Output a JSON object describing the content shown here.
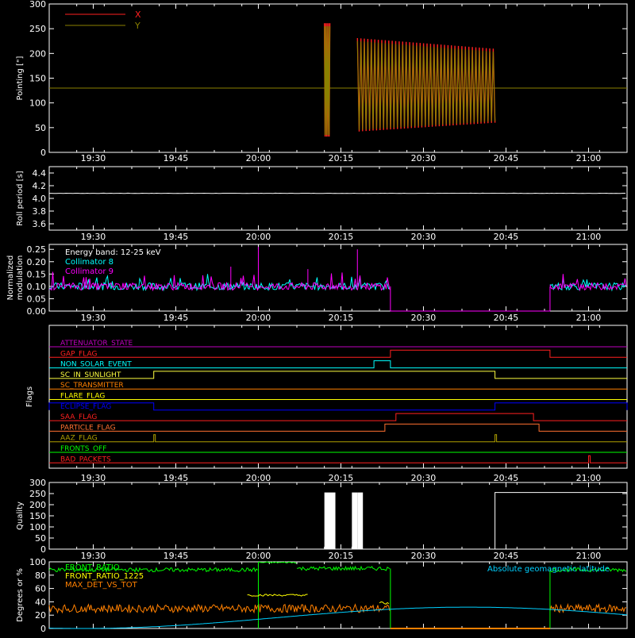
{
  "chart_data": [
    {
      "type": "line",
      "ylabel": "Pointing [\"]",
      "ylim": [
        0,
        300
      ],
      "yticks": [
        0,
        50,
        100,
        150,
        200,
        250,
        300
      ],
      "xlim": [
        "19:22",
        "21:07"
      ],
      "xticks": [
        "19:30",
        "19:45",
        "20:00",
        "20:15",
        "20:30",
        "20:45",
        "21:00"
      ],
      "legend": [
        {
          "name": "X",
          "color": "#ff2020"
        },
        {
          "name": "Y",
          "color": "#8b8000"
        }
      ],
      "baseline": 130,
      "bursts": [
        {
          "start": "20:12",
          "end": "20:13",
          "low": 35,
          "high": 255
        },
        {
          "start": "20:18",
          "end": "20:43",
          "low": 45,
          "high": 225
        }
      ]
    },
    {
      "type": "line",
      "ylabel": "Roll period [s]",
      "ylim": [
        3.5,
        4.5
      ],
      "yticks": [
        "3.6",
        "3.8",
        "4.0",
        "4.2",
        "4.4"
      ],
      "value": 4.08,
      "series": [
        {
          "color": "#ffffff"
        }
      ]
    },
    {
      "type": "line",
      "ylabel": "Normalized modulation",
      "ylim": [
        0,
        0.27
      ],
      "yticks": [
        "0.00",
        "0.05",
        "0.10",
        "0.15",
        "0.20",
        "0.25"
      ],
      "annotation": "Energy band: 12-25 keV",
      "series": [
        {
          "name": "Collimator 8",
          "color": "#00ffff",
          "level": 0.1
        },
        {
          "name": "Collimator 9",
          "color": "#ff00ff",
          "level": 0.1
        }
      ],
      "gap": {
        "start": "20:24",
        "end": "20:53"
      }
    },
    {
      "type": "line",
      "ylabel": "Flags",
      "flags": [
        {
          "name": "ATTENUATOR_STATE",
          "color": "#c000c0",
          "high": []
        },
        {
          "name": "GAP_FLAG",
          "color": "#ff2020",
          "high": [
            [
              "20:24",
              "20:53"
            ]
          ]
        },
        {
          "name": "NON_SOLAR_EVENT",
          "color": "#00ffff",
          "high": [
            [
              "20:21",
              "20:24"
            ]
          ]
        },
        {
          "name": "SC_IN_SUNLIGHT",
          "color": "#ffff40",
          "high": [
            [
              "19:41",
              "20:43"
            ]
          ]
        },
        {
          "name": "SC_TRANSMITTER",
          "color": "#ff8000",
          "high": []
        },
        {
          "name": "FLARE_FLAG",
          "color": "#ffff00",
          "high": []
        },
        {
          "name": "ECLIPSE_FLAG",
          "color": "#0000ff",
          "high": [
            [
              "19:22",
              "19:41"
            ],
            [
              "20:43",
              "21:07"
            ]
          ]
        },
        {
          "name": "SAA_FLAG",
          "color": "#ff2020",
          "high": [
            [
              "20:25",
              "20:50"
            ]
          ]
        },
        {
          "name": "PARTICLE_FLAG",
          "color": "#ff7030",
          "high": [
            [
              "20:23",
              "20:51"
            ]
          ]
        },
        {
          "name": "AAZ_FLAG",
          "color": "#b0a000",
          "high": [
            [
              "19:41",
              "19:41"
            ],
            [
              "20:43",
              "20:43"
            ]
          ]
        },
        {
          "name": "FRONTS_OFF",
          "color": "#00ff00",
          "high": []
        },
        {
          "name": "BAD_PACKETS",
          "color": "#ff2020",
          "high": [
            [
              "21:00",
              "21:00"
            ]
          ]
        }
      ]
    },
    {
      "type": "line",
      "ylabel": "Quality",
      "ylim": [
        0,
        300
      ],
      "yticks": [
        0,
        50,
        100,
        150,
        200,
        250,
        300
      ],
      "high": 255,
      "segments": [
        {
          "start": "20:12",
          "end": "20:14"
        },
        {
          "start": "20:17",
          "end": "20:18"
        },
        {
          "start": "20:18",
          "end": "20:19"
        },
        {
          "start": "20:43",
          "end": "21:07"
        }
      ]
    },
    {
      "type": "line",
      "ylabel": "Degrees or %",
      "ylim": [
        0,
        100
      ],
      "yticks": [
        0,
        20,
        40,
        60,
        80,
        100
      ],
      "legend_left": [
        {
          "name": "FRONT_RATIO",
          "color": "#00ff00"
        },
        {
          "name": "FRONT_RATIO_1225",
          "color": "#ffff00"
        },
        {
          "name": "MAX_DET_VS_TOT",
          "color": "#ff8000"
        }
      ],
      "legend_right": [
        {
          "name": "Absolute geomagnetic latitude",
          "color": "#00d0ff"
        }
      ],
      "gap": {
        "start": "20:24",
        "end": "20:53"
      }
    }
  ]
}
